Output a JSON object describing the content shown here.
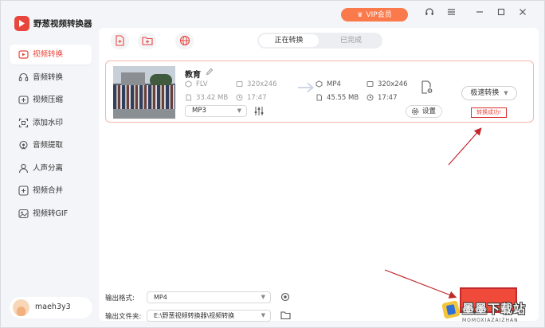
{
  "app": {
    "title": "野葱视频转换器",
    "accent": "#e8453c"
  },
  "titlebar": {
    "vip_label": "VIP会员"
  },
  "sidebar": {
    "items": [
      {
        "label": "视频转换",
        "icon": "video-convert-icon",
        "active": true
      },
      {
        "label": "音频转换",
        "icon": "audio-convert-icon"
      },
      {
        "label": "视频压缩",
        "icon": "video-compress-icon"
      },
      {
        "label": "添加水印",
        "icon": "watermark-icon"
      },
      {
        "label": "音频提取",
        "icon": "audio-extract-icon"
      },
      {
        "label": "人声分离",
        "icon": "voice-separate-icon"
      },
      {
        "label": "视频合并",
        "icon": "video-merge-icon"
      },
      {
        "label": "视频转GIF",
        "icon": "gif-icon"
      }
    ]
  },
  "user": {
    "name": "maeh3y3"
  },
  "tabs": {
    "converting": "正在转换",
    "completed": "已完成"
  },
  "task": {
    "name": "教育",
    "source": {
      "format": "FLV",
      "resolution": "320x246",
      "size": "33.42 MB",
      "duration": "17:47"
    },
    "target": {
      "format": "MP4",
      "resolution": "320x246",
      "size": "45.55 MB",
      "duration": "17:47"
    },
    "audio_format": "MP3",
    "settings_label": "设置",
    "convert_label": "极速转换",
    "status": "转换成功!"
  },
  "output": {
    "format_label": "输出格式:",
    "format_value": "MP4",
    "folder_label": "输出文件夹:",
    "folder_value": "E:\\野葱视频转换器\\视频转换"
  },
  "watermark": {
    "text": "墨墨下载站",
    "sub": "MOMOXIAZAIZHAN"
  }
}
